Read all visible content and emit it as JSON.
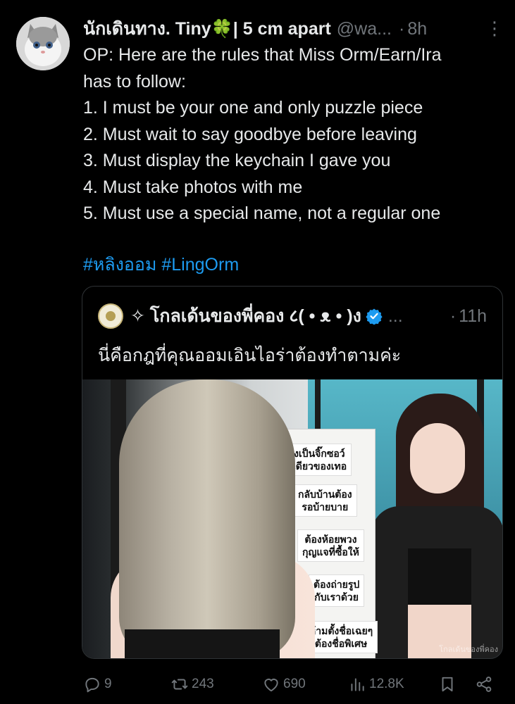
{
  "post": {
    "author": {
      "display_name": "นักเดินทาง. Tiny🍀| 5 cm apart",
      "handle": "@wa...",
      "separator": "·",
      "time": "8h",
      "avatar_icon": "cat-avatar-icon"
    },
    "body_lines": [
      "OP: Here are the rules that Miss Orm/Earn/Ira",
      "has to follow:",
      "1. I must be your one and only puzzle piece",
      "2. Must wait to say goodbye before leaving",
      "3. Must display the keychain I gave you",
      "4. Must take photos with me",
      "5. Must use a special name, not a regular one"
    ],
    "hashtags": [
      "#หลิงออม",
      "#LingOrm"
    ],
    "accent_color": "#1d9bf0"
  },
  "quote": {
    "author": {
      "display_name": "✧ โกลเด้นของพี่คอง ८( • ᴥ • )ง",
      "more": "...",
      "separator": "·",
      "time": "11h",
      "verified_icon": "verified-badge-icon"
    },
    "text": "นี่คือกฎที่คุณออมเอินไอร่าต้องทำตามค่ะ",
    "image": {
      "board_labels": [
        "ต้องเป็นจิ๊กซอว์\nอันเดียวของเทอ",
        "กลับบ้านต้อง\nรอบ้ายบาย",
        "ต้องห้อยพวง\nกุญแจที่ซื้อให้",
        "ต้องถ่ายรูป\nกับเราด้วย",
        "ห้ามตั้งชื่อเฉยๆ\nต้องชื่อพิเศษ"
      ],
      "watermark": "โกลเด้นของพี่คอง"
    }
  },
  "actions": {
    "reply_count": "9",
    "repost_count": "243",
    "like_count": "690",
    "view_count": "12.8K"
  }
}
